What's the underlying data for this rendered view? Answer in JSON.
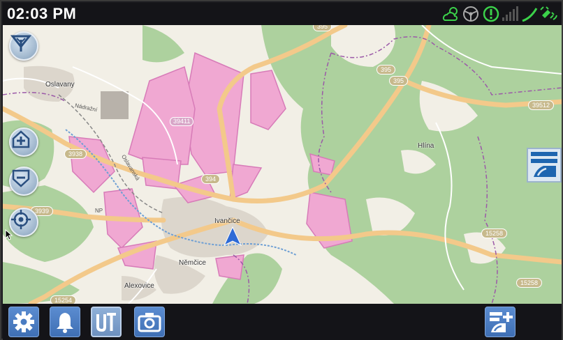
{
  "status": {
    "time": "02:03 PM",
    "icons": [
      "weather-cloud-sun-icon",
      "steering-wheel-icon",
      "alert-warning-icon",
      "signal-strength-icon",
      "gps-satellite-icon"
    ]
  },
  "map": {
    "places": {
      "oslavany": "Oslavany",
      "ivancice": "Ivančice",
      "nemcice": "Němčice",
      "alexovice": "Alexovice",
      "hlina": "Hlína"
    },
    "streets": {
      "nadrazni": "Nádražní",
      "oslavanska": "Oslavanská"
    },
    "road_labels": {
      "r395a": "395",
      "r395b": "395",
      "r395c": "395",
      "r39512": "39512",
      "r39411": "39411",
      "r394": "394",
      "r3938": "3938",
      "r3939": "3939",
      "r15258a": "15258",
      "r15258b": "15258",
      "r15254": "15254",
      "np": "NP"
    },
    "colors": {
      "forest": "#add19e",
      "field": "#f0a8d2",
      "road": "#f7c98a",
      "background": "#f2efe6"
    }
  },
  "map_controls": [
    "navigation-compass-icon",
    "zoom-in-home-icon",
    "zoom-out-icon",
    "center-location-icon",
    "map-layers-icon"
  ],
  "bottom_bar": [
    "settings-gear-icon",
    "notification-bell-icon",
    "universal-terminal-icon",
    "camera-icon",
    "add-map-layer-icon"
  ]
}
